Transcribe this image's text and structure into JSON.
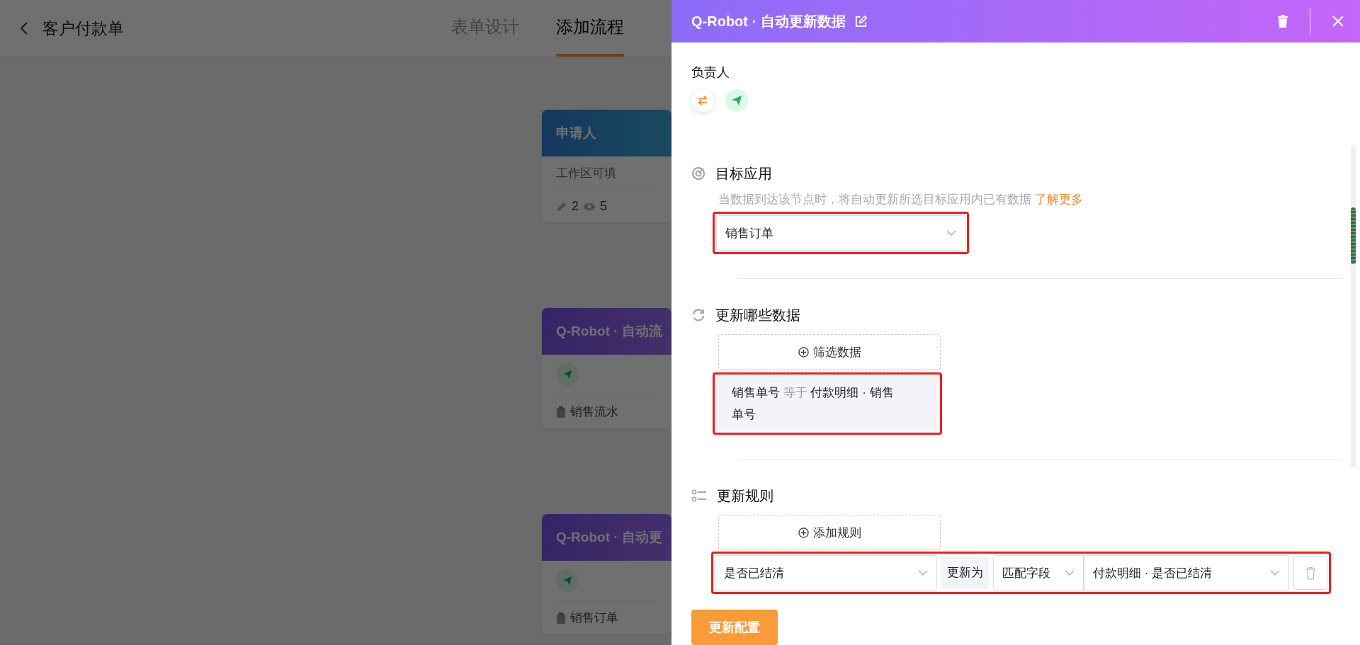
{
  "page": {
    "title": "客户付款单",
    "tabs": [
      {
        "label": "表单设计",
        "selected": false
      },
      {
        "label": "添加流程",
        "selected": true
      }
    ]
  },
  "flow_nodes": [
    {
      "kind": "applicant",
      "title": "申请人",
      "note": "工作区可填",
      "edit_count": "2",
      "view_count": "5"
    },
    {
      "kind": "robot",
      "title": "Q-Robot · 自动流",
      "target": "销售流水"
    },
    {
      "kind": "robot",
      "title": "Q-Robot · 自动更",
      "target": "销售订单"
    }
  ],
  "drawer": {
    "title": "Q-Robot · 自动更新数据",
    "owner_label": "负责人",
    "target_app": {
      "title": "目标应用",
      "description": "当数据到达该节点时，将自动更新所选目标应用内已有数据",
      "link": "了解更多",
      "value": "销售订单",
      "highlighted": true
    },
    "filter": {
      "title": "更新哪些数据",
      "add_button": "筛选数据",
      "condition": {
        "field": "销售单号",
        "operator": "等于",
        "value": "付款明细 · 销售单号"
      },
      "highlighted": true
    },
    "rules": {
      "title": "更新规则",
      "add_button": "添加规则",
      "items": [
        {
          "field": "是否已结清",
          "connector": "更新为",
          "mode": "匹配字段",
          "source": "付款明细 · 是否已结清",
          "highlighted": true
        }
      ]
    },
    "submit_button": "更新配置"
  }
}
